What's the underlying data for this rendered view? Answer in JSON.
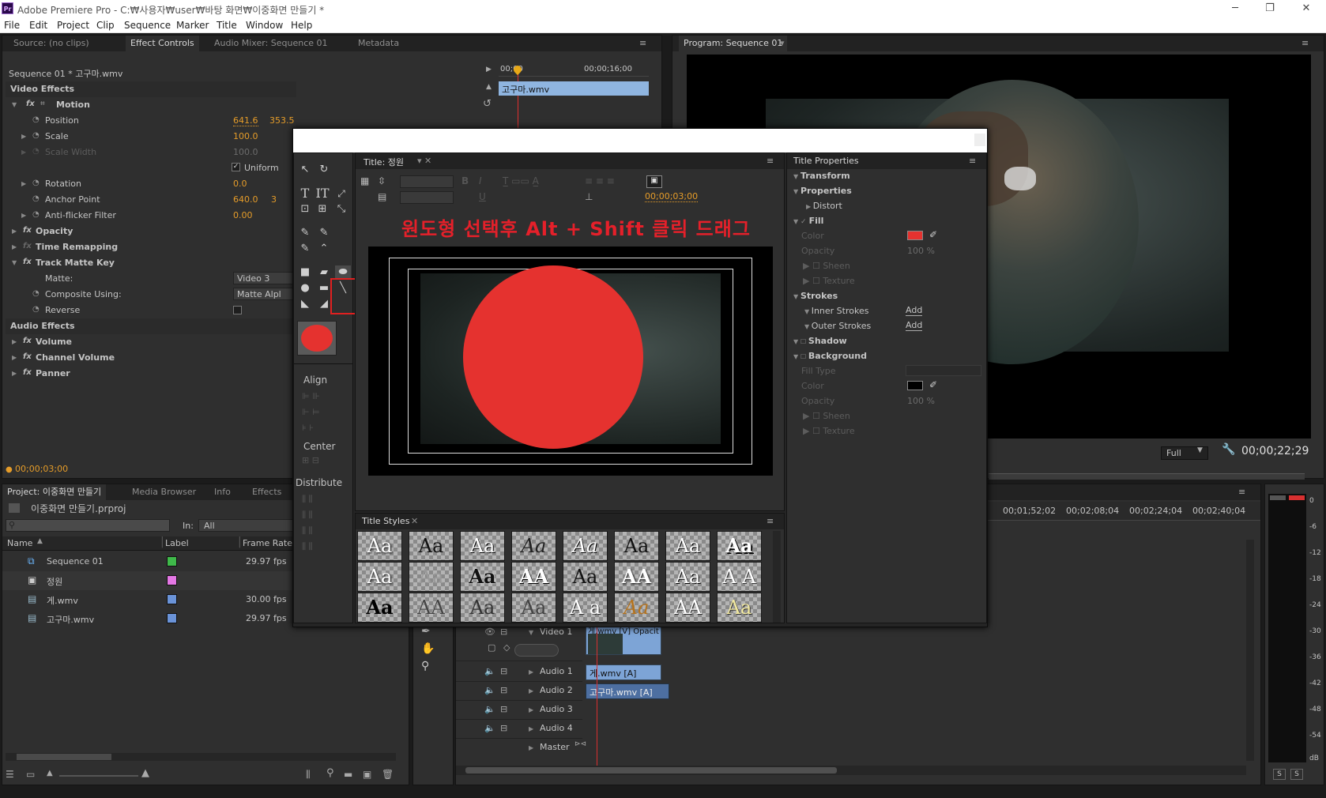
{
  "app": {
    "title": "Adobe Premiere Pro - C:₩사용자₩user₩바탕 화면₩이중화면 만들기 *",
    "icon": "Pr",
    "window_controls": [
      "─",
      "❐",
      "✕"
    ]
  },
  "menu": [
    "File",
    "Edit",
    "Project",
    "Clip",
    "Sequence",
    "Marker",
    "Title",
    "Window",
    "Help"
  ],
  "source_tabs": [
    "Source: (no clips)",
    "Effect Controls",
    "Audio Mixer: Sequence 01",
    "Metadata"
  ],
  "effect_controls": {
    "header": "Sequence 01 * 고구마.wmv",
    "clip_label": "고구마.wmv",
    "ruler_start": "00;00",
    "ruler_mid": "00;00;16;00",
    "video_effects": "Video Effects",
    "motion": "Motion",
    "position": {
      "label": "Position",
      "x": "641.6",
      "y": "353.5"
    },
    "scale": {
      "label": "Scale",
      "value": "100.0"
    },
    "scale_width": {
      "label": "Scale Width",
      "value": "100.0"
    },
    "uniform": "Uniform",
    "rotation": {
      "label": "Rotation",
      "value": "0.0"
    },
    "anchor": {
      "label": "Anchor Point",
      "x": "640.0",
      "y": "3"
    },
    "antiflicker": {
      "label": "Anti-flicker Filter",
      "value": "0.00"
    },
    "opacity": "Opacity",
    "time_remap": "Time Remapping",
    "track_matte": "Track Matte Key",
    "matte": {
      "label": "Matte:",
      "value": "Video 3"
    },
    "composite": {
      "label": "Composite Using:",
      "value": "Matte Alpl"
    },
    "reverse": "Reverse",
    "audio_effects": "Audio Effects",
    "volume": "Volume",
    "channel_volume": "Channel Volume",
    "panner": "Panner",
    "timecode": "00;00;03;00"
  },
  "program": {
    "tab": "Program: Sequence 01",
    "zoom": "Full",
    "timecode": "00;00;22;29"
  },
  "project": {
    "tabs": [
      "Project: 이중화면 만들기",
      "Media Browser",
      "Info",
      "Effects"
    ],
    "file": "이중화면 만들기.prproj",
    "in_label": "In:",
    "in_value": "All",
    "columns": [
      "Name",
      "Label",
      "Frame Rate"
    ],
    "items": [
      {
        "name": "Sequence 01",
        "color": "#3fb94a",
        "fps": "29.97 fps"
      },
      {
        "name": "정원",
        "color": "#e477e4",
        "fps": ""
      },
      {
        "name": "게.wmv",
        "color": "#6a93d8",
        "fps": "30.00 fps"
      },
      {
        "name": "고구마.wmv",
        "color": "#6a93d8",
        "fps": "29.97 fps"
      }
    ]
  },
  "titler": {
    "tab": "Title: 정원",
    "timecode": "00;00;03;00",
    "annotation": "원도형 선택후 Alt + Shift 클릭 드래그",
    "align": "Align",
    "center": "Center",
    "distribute": "Distribute",
    "styles_tab": "Title Styles",
    "styles": [
      "Aa",
      "Aa",
      "Aa",
      "Aa",
      "Aa",
      "Aa",
      "Aa",
      "Aa",
      "Aa",
      "Aa",
      "Aa",
      "AA",
      "Aa",
      "AA",
      "Aa",
      "A A",
      "Aa",
      "AA",
      "Aa",
      "Aa",
      "A a",
      "Aa",
      "AA",
      "Aa"
    ],
    "fill_color": "#e5322f"
  },
  "title_properties": {
    "tab": "Title Properties",
    "transform": "Transform",
    "properties": "Properties",
    "distort": "Distort",
    "fill": "Fill",
    "color": "Color",
    "opacity": "Opacity",
    "opacity_value": "100 %",
    "sheen": "Sheen",
    "texture": "Texture",
    "strokes": "Strokes",
    "inner": "Inner Strokes",
    "outer": "Outer Strokes",
    "add": "Add",
    "shadow": "Shadow",
    "background": "Background",
    "fill_type": "Fill Type",
    "bg_color": "Color",
    "bg_opacity": "Opacity",
    "bg_opacity_value": "100 %",
    "bg_sheen": "Sheen",
    "bg_texture": "Texture"
  },
  "timeline": {
    "ruler": [
      "00;01;52;02",
      "00;02;08;04",
      "00;02;24;04",
      "00;02;40;04"
    ],
    "tracks": [
      "Video 1",
      "Audio 1",
      "Audio 2",
      "Audio 3",
      "Audio 4",
      "Master"
    ],
    "clips": {
      "video": "게.wmv [V] Opacity",
      "audio1": "게.wmv [A]",
      "audio2": "고구마.wmv [A]"
    }
  },
  "meters": {
    "ticks": [
      "0",
      "-6",
      "-12",
      "-18",
      "-24",
      "-30",
      "-36",
      "-42",
      "-48",
      "-54",
      "dB"
    ],
    "buttons": [
      "S",
      "S"
    ]
  }
}
